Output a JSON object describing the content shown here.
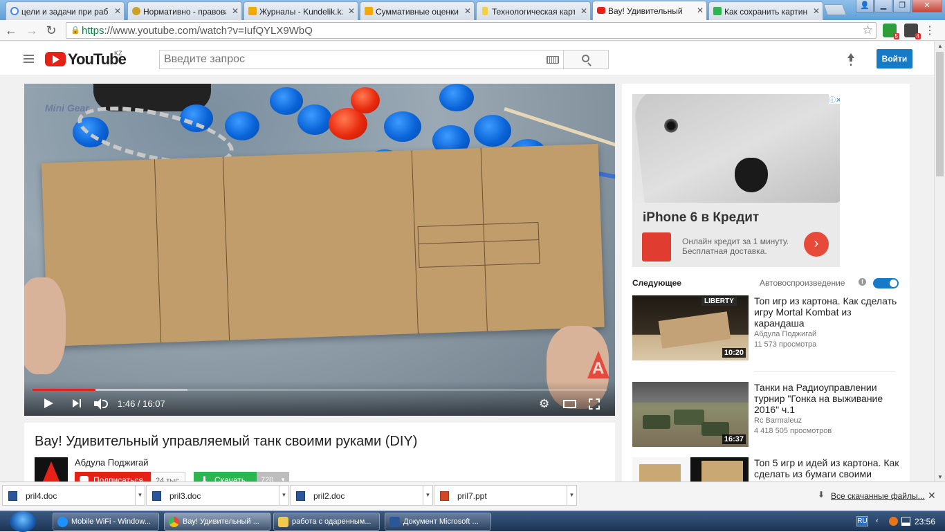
{
  "browser": {
    "tabs": [
      {
        "label": "цели и задачи при раб",
        "icon": "google-icon",
        "color": "#4285f4"
      },
      {
        "label": "Нормативно - правова",
        "icon": "seal-icon",
        "color": "#c9a227"
      },
      {
        "label": "Журналы - Kundelik.kz",
        "icon": "kundelik-icon",
        "color": "#f2a900"
      },
      {
        "label": "Суммативные оценки",
        "icon": "kundelik-icon",
        "color": "#f2a900"
      },
      {
        "label": "Технологическая карт",
        "icon": "doc-icon",
        "color": "#f4d03f"
      },
      {
        "label": "Вау! Удивительный",
        "icon": "youtube-icon",
        "color": "#e62117",
        "active": true
      },
      {
        "label": "Как сохранить картин",
        "icon": "green-icon",
        "color": "#2cb650"
      }
    ],
    "url_scheme": "https",
    "url_rest": "://www.youtube.com/watch?v=IufQYLX9WbQ",
    "extensions": [
      {
        "name": "green-extension-icon",
        "badge": "5",
        "color": "#2e9d3a"
      },
      {
        "name": "gray-extension-icon",
        "badge": "4",
        "color": "#444444"
      }
    ]
  },
  "youtube": {
    "logo_text": "YouTube",
    "country": "KZ",
    "search_placeholder": "Введите запрос",
    "signin_label": "Войти"
  },
  "player": {
    "watermark": "Mini Gear",
    "time": "1:46 / 16:07",
    "progress": 0.11,
    "buffered": 0.27
  },
  "video": {
    "title": "Вау! Удивительный управляемый танк своими руками (DIY)",
    "channel": "Абдула Поджигай",
    "subscribe_label": "Подписаться",
    "subscriber_count": "24 тыс.",
    "download_label": "Скачать",
    "download_quality": "720"
  },
  "ad": {
    "title": "iPhone 6 в Кредит",
    "text": "Онлайн кредит за 1 минуту. Бесплатная доставка.",
    "go_symbol": "›"
  },
  "sidebar": {
    "next_label": "Следующее",
    "autoplay_label": "Автовоспроизведение",
    "autoplay_on": true,
    "items": [
      {
        "title": "Топ игр из картона. Как сделать игру Mortal Kombat из карандаша",
        "channel": "Абдула Поджигай",
        "views": "11 573 просмотра",
        "duration": "10:20",
        "thumb_label": "LIBERTY"
      },
      {
        "title": "Танки на Радиоуправлении турнир \"Гонка на выживание 2016\" ч.1",
        "channel": "Rc Barmaleuz",
        "views": "4 418 505 просмотров",
        "duration": "16:37"
      },
      {
        "title": "Топ 5 игр и идей из картона. Как сделать из бумаги своими",
        "channel": "",
        "views": "",
        "duration": ""
      }
    ]
  },
  "downloads": {
    "files": [
      "pril4.doc",
      "pril3.doc",
      "pril2.doc",
      "pril7.ppt"
    ],
    "show_all": "Все скачанные файлы..."
  },
  "taskbar": {
    "items": [
      {
        "label": "Mobile WiFi - Window...",
        "icon": "ie-icon",
        "color": "#1e90ff"
      },
      {
        "label": "Вау! Удивительный ...",
        "icon": "chrome-icon",
        "color": "#e8453c"
      },
      {
        "label": "работа с одаренным...",
        "icon": "folder-icon",
        "color": "#f2c94c"
      },
      {
        "label": "Документ Microsoft ...",
        "icon": "word-icon",
        "color": "#2b579a"
      }
    ],
    "lang": "RU",
    "time": "23:56"
  }
}
